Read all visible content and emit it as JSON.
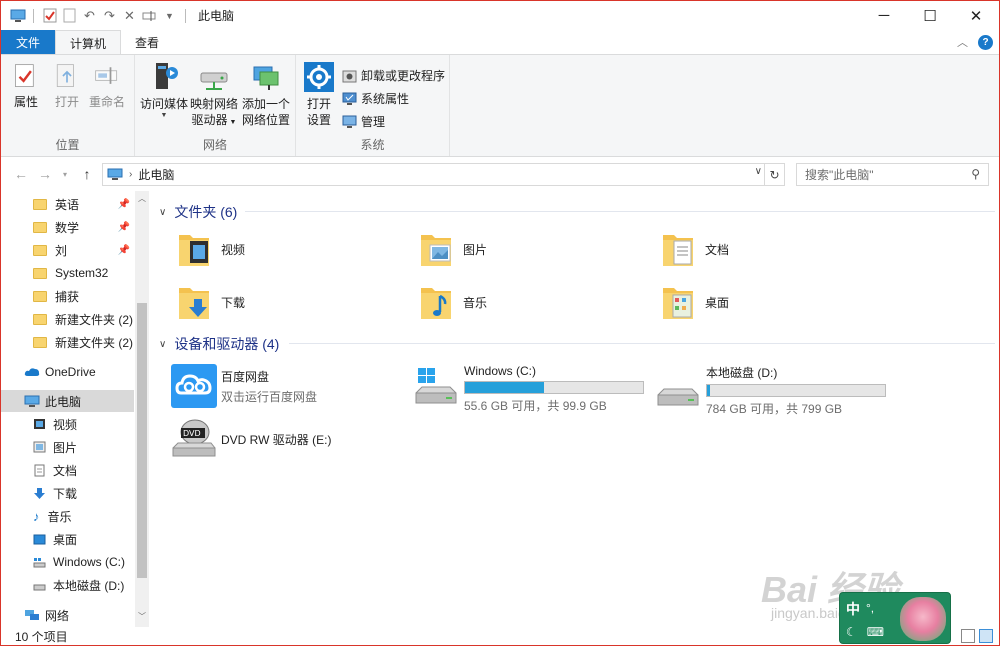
{
  "window": {
    "title": "此电脑",
    "caption": {
      "minimize": "─",
      "maximize": "☐",
      "close": "✕"
    }
  },
  "qat_icons": [
    "computer-icon",
    "properties-icon",
    "new-folder-icon",
    "undo-icon",
    "redo-icon",
    "delete-icon",
    "rename-icon",
    "customize-dropdown-icon"
  ],
  "tabs": [
    {
      "label": "文件",
      "kind": "file"
    },
    {
      "label": "计算机",
      "kind": "active"
    },
    {
      "label": "查看",
      "kind": "normal"
    }
  ],
  "ribbon": {
    "groups": {
      "location": "位置",
      "network": "网络",
      "system": "系统"
    },
    "properties": "属性",
    "open": "打开",
    "rename": "重命名",
    "access_media": "访问媒体",
    "map_drive_1": "映射网络",
    "map_drive_2": "驱动器",
    "add_location_1": "添加一个",
    "add_location_2": "网络位置",
    "open_settings_1": "打开",
    "open_settings_2": "设置",
    "uninstall": "卸载或更改程序",
    "sys_props": "系统属性",
    "manage": "管理"
  },
  "address": {
    "path": "此电脑",
    "search_placeholder": "搜索\"此电脑\""
  },
  "nav": [
    {
      "label": "英语",
      "type": "folder",
      "pinned": true
    },
    {
      "label": "数学",
      "type": "folder",
      "pinned": true
    },
    {
      "label": "刘",
      "type": "folder",
      "pinned": true
    },
    {
      "label": "System32",
      "type": "folder",
      "pinned": false
    },
    {
      "label": "捕获",
      "type": "folder",
      "pinned": false
    },
    {
      "label": "新建文件夹 (2)",
      "type": "folder",
      "pinned": false
    },
    {
      "label": "新建文件夹 (2)",
      "type": "folder",
      "pinned": false
    },
    {
      "label": "OneDrive",
      "type": "onedrive"
    },
    {
      "label": "此电脑",
      "type": "pc",
      "selected": true
    },
    {
      "label": "视频",
      "type": "video"
    },
    {
      "label": "图片",
      "type": "pictures"
    },
    {
      "label": "文档",
      "type": "documents"
    },
    {
      "label": "下载",
      "type": "downloads"
    },
    {
      "label": "音乐",
      "type": "music"
    },
    {
      "label": "桌面",
      "type": "desktop"
    },
    {
      "label": "Windows (C:)",
      "type": "drive"
    },
    {
      "label": "本地磁盘 (D:)",
      "type": "drive"
    },
    {
      "label": "网络",
      "type": "network"
    }
  ],
  "sections": {
    "folders": "文件夹 (6)",
    "devices": "设备和驱动器 (4)"
  },
  "folders": [
    {
      "label": "视频",
      "icon": "video-folder-icon"
    },
    {
      "label": "图片",
      "icon": "pictures-folder-icon"
    },
    {
      "label": "文档",
      "icon": "documents-folder-icon"
    },
    {
      "label": "下载",
      "icon": "downloads-folder-icon"
    },
    {
      "label": "音乐",
      "icon": "music-folder-icon"
    },
    {
      "label": "桌面",
      "icon": "desktop-folder-icon"
    }
  ],
  "devices": [
    {
      "name": "百度网盘",
      "sub": "双击运行百度网盘",
      "icon": "baidu-netdisk-icon"
    },
    {
      "name": "Windows (C:)",
      "sub": "55.6 GB 可用，共 99.9 GB",
      "used_fraction": 0.443,
      "icon": "system-drive-icon"
    },
    {
      "name": "本地磁盘 (D:)",
      "sub": "784 GB 可用，共 799 GB",
      "used_fraction": 0.019,
      "icon": "local-drive-icon"
    },
    {
      "name": "DVD RW 驱动器 (E:)",
      "sub": "",
      "icon": "dvd-drive-icon"
    }
  ],
  "status": {
    "count": "10 个项目"
  },
  "watermark": {
    "brand": "Bai 经验",
    "url": "jingyan.baidu.com"
  },
  "ime": {
    "lang": "中",
    "punct": "°,",
    "mode": "☾",
    "keyboard": "⌨"
  },
  "colors": {
    "accent": "#1979ca",
    "bar": "#26a0da",
    "section": "#1e3287",
    "folder": "#f8d46f"
  }
}
